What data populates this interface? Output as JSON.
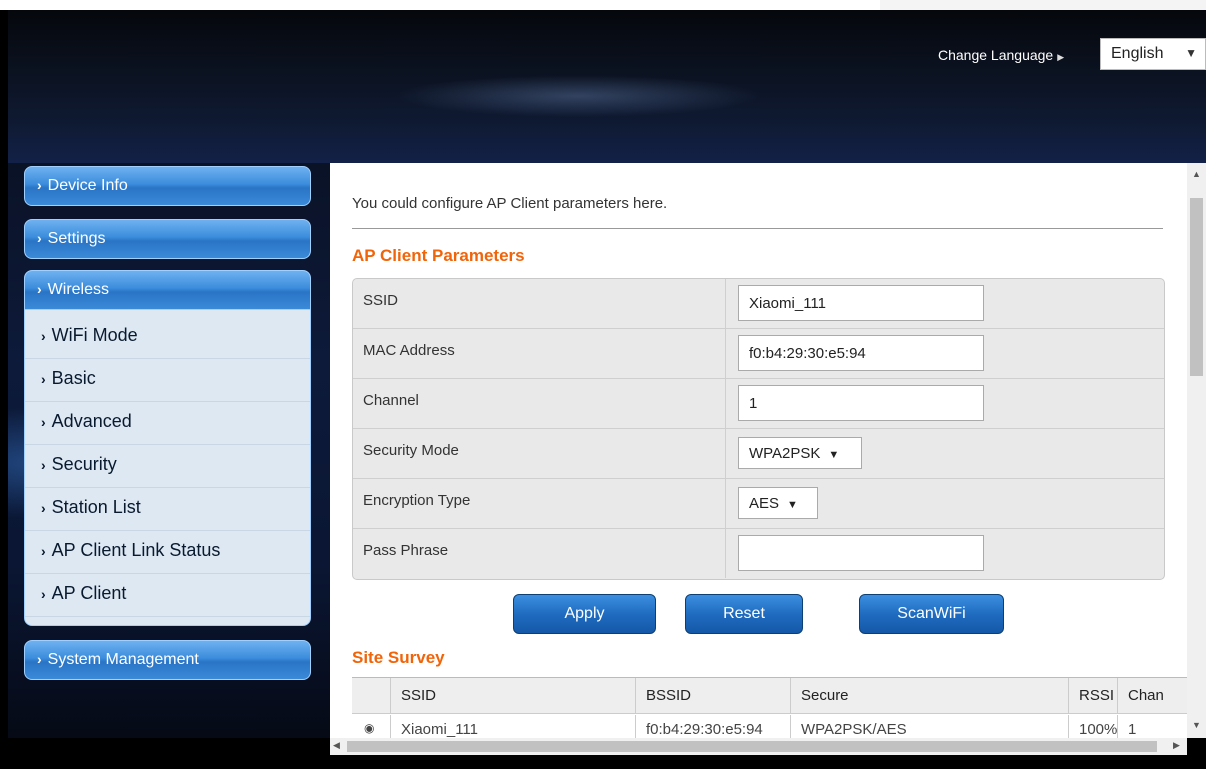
{
  "header": {
    "change_language_label": "Change Language",
    "language_value": "English"
  },
  "sidebar": {
    "device_info": "Device Info",
    "settings": "Settings",
    "wireless": "Wireless",
    "wireless_items": [
      "WiFi Mode",
      "Basic",
      "Advanced",
      "Security",
      "Station List",
      "AP Client Link Status",
      "AP Client"
    ],
    "system_management": "System Management"
  },
  "main": {
    "intro": "You could configure AP Client parameters here.",
    "params_title": "AP Client Parameters",
    "params": {
      "ssid_label": "SSID",
      "ssid_value": "Xiaomi_111",
      "mac_label": "MAC Address",
      "mac_value": "f0:b4:29:30:e5:94",
      "channel_label": "Channel",
      "channel_value": "1",
      "security_label": "Security Mode",
      "security_value": "WPA2PSK",
      "encryption_label": "Encryption Type",
      "encryption_value": "AES",
      "pass_label": "Pass Phrase",
      "pass_value": ""
    },
    "buttons": {
      "apply": "Apply",
      "reset": "Reset",
      "scan": "ScanWiFi"
    },
    "survey_title": "Site Survey",
    "survey": {
      "headers": [
        "SSID",
        "BSSID",
        "Secure",
        "RSSI",
        "Chan"
      ],
      "row": [
        "Xiaomi_111",
        "f0:b4:29:30:e5:94",
        "WPA2PSK/AES",
        "100%",
        "1"
      ]
    }
  },
  "colors": {
    "accent_orange": "#f0640a",
    "nav_blue": "#2a74c6",
    "button_blue": "#1f6cc0"
  }
}
